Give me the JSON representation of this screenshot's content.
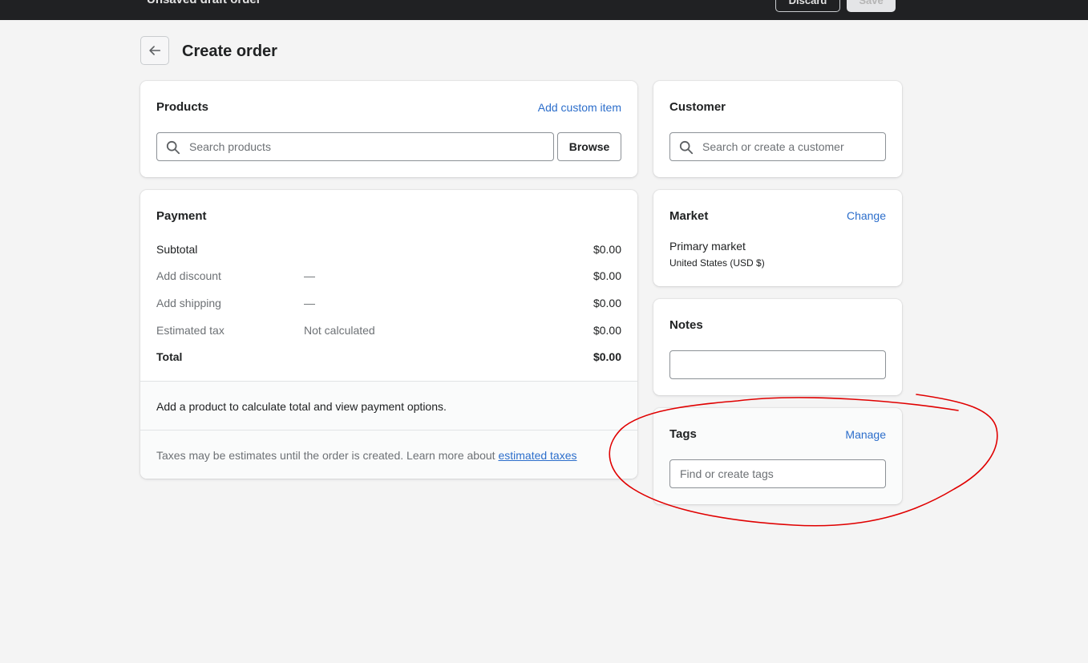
{
  "topbar": {
    "title": "Unsaved draft order",
    "discard_label": "Discard",
    "save_label": "Save"
  },
  "page": {
    "title": "Create order",
    "back_icon": "arrow-left-icon"
  },
  "products": {
    "title": "Products",
    "add_custom_item": "Add custom item",
    "search_placeholder": "Search products",
    "browse_label": "Browse",
    "search_icon": "search-icon"
  },
  "payment": {
    "title": "Payment",
    "rows": [
      {
        "label": "Subtotal",
        "detail": "",
        "amount": "$0.00"
      },
      {
        "label": "Add discount",
        "detail": "—",
        "amount": "$0.00"
      },
      {
        "label": "Add shipping",
        "detail": "—",
        "amount": "$0.00"
      },
      {
        "label": "Estimated tax",
        "detail": "Not calculated",
        "amount": "$0.00"
      },
      {
        "label": "Total",
        "detail": "",
        "amount": "$0.00"
      }
    ],
    "info_message": "Add a product to calculate total and view payment options.",
    "tax_note": "Taxes may be estimates until the order is created. Learn more about ",
    "tax_link": "estimated taxes"
  },
  "customer": {
    "title": "Customer",
    "search_placeholder": "Search or create a customer",
    "search_icon": "search-icon"
  },
  "market": {
    "title": "Market",
    "change_label": "Change",
    "name": "Primary market",
    "region": "United States (USD $)"
  },
  "notes": {
    "title": "Notes",
    "value": ""
  },
  "tags": {
    "title": "Tags",
    "manage_label": "Manage",
    "placeholder": "Find or create tags"
  },
  "colors": {
    "accent_link": "#2c6ecb",
    "topbar": "#202123",
    "annotation": "#e00000"
  }
}
